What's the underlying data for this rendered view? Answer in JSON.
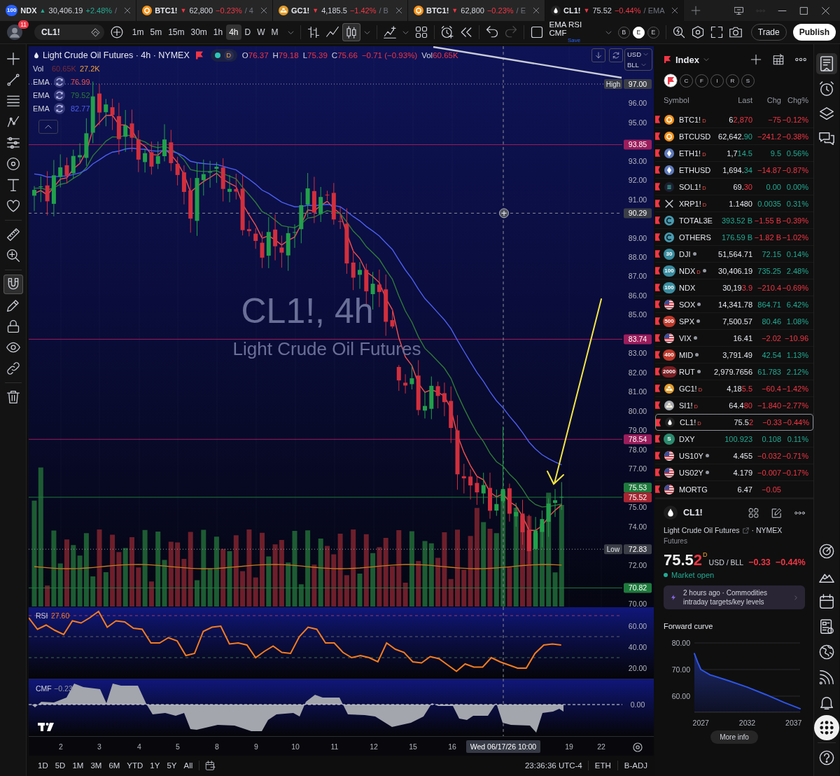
{
  "tabs": [
    {
      "symbol": "NDX",
      "arrow": "▲",
      "price": "30,406.19",
      "change": "+2.48%",
      "suffix": "/",
      "up": true,
      "selected": false,
      "logo": {
        "kind": "badge",
        "text": "100",
        "color": "#2962ff"
      }
    },
    {
      "symbol": "BTC1!",
      "arrow": "▼",
      "price": "62,800",
      "change": "−0.23%",
      "suffix": "/ 4",
      "up": false,
      "selected": false,
      "logo": {
        "kind": "coin",
        "color": "#f7931a"
      }
    },
    {
      "symbol": "GC1!",
      "arrow": "▼",
      "price": "4,185.5",
      "change": "−1.42%",
      "suffix": "/ B",
      "up": false,
      "selected": false,
      "logo": {
        "kind": "bars",
        "color": "#e39c2b"
      }
    },
    {
      "symbol": "BTC1!",
      "arrow": "▼",
      "price": "62,800",
      "change": "−0.23%",
      "suffix": "/ E",
      "up": false,
      "selected": false,
      "logo": {
        "kind": "coin",
        "color": "#f7931a"
      }
    },
    {
      "symbol": "CL1!",
      "arrow": "▼",
      "price": "75.52",
      "change": "−0.44%",
      "suffix": "/ EMA",
      "up": false,
      "selected": true,
      "logo": {
        "kind": "drop"
      }
    }
  ],
  "toolbar": {
    "notification_count": "11",
    "symbol": "CL1!",
    "intervals": [
      {
        "label": "1m",
        "selected": false
      },
      {
        "label": "5m",
        "selected": false
      },
      {
        "label": "15m",
        "selected": false
      },
      {
        "label": "30m",
        "selected": false
      },
      {
        "label": "1h",
        "selected": false
      },
      {
        "label": "4h",
        "selected": true
      },
      {
        "label": "D",
        "selected": false
      },
      {
        "label": "W",
        "selected": false
      },
      {
        "label": "M",
        "selected": false
      }
    ],
    "chart_styles": [
      {
        "selected": false
      },
      {
        "selected": false
      },
      {
        "selected": true
      }
    ],
    "history": [
      {
        "disabled": false
      },
      {
        "disabled": true
      }
    ],
    "layout": {
      "name": "EMA RSI CMF",
      "status": "Save"
    },
    "sessions": [
      {
        "label": "B",
        "selected": false
      },
      {
        "label": "E",
        "selected": true
      },
      {
        "label": "E",
        "selected": false
      }
    ],
    "trade": "Trade",
    "publish": "Publish"
  },
  "drawing_tools": [
    {
      "selected": false
    },
    {
      "selected": false
    },
    {
      "selected": false
    },
    {
      "selected": false
    },
    {
      "selected": false
    },
    {
      "selected": false
    },
    {
      "selected": false
    },
    {
      "selected": false
    },
    {
      "selected": false
    },
    {
      "selected": false
    },
    {
      "selected": true
    },
    {
      "selected": false
    },
    {
      "selected": false
    },
    {
      "selected": false
    },
    {
      "selected": false
    },
    {
      "selected": false
    }
  ],
  "chart": {
    "title": "Light Crude Oil Futures · 4h · NYMEX",
    "session_badge": "D",
    "ohlc": [
      {
        "label": "O",
        "value": "76.37"
      },
      {
        "label": "H",
        "value": "79.18"
      },
      {
        "label": "L",
        "value": "75.39"
      },
      {
        "label": "C",
        "value": "75.66"
      }
    ],
    "change": "−0.71 (−0.93%)",
    "up": false,
    "volume": {
      "label": "Vol",
      "value": "60.65K"
    },
    "volume_legend": {
      "label": "Vol",
      "values": [
        {
          "text": "60.65K",
          "color": "#7a2b33"
        },
        {
          "text": "27.2K",
          "color": "#f0a035"
        }
      ]
    },
    "emas": [
      {
        "label": "EMA",
        "value": "76.99",
        "color": "#f0504f"
      },
      {
        "label": "EMA",
        "value": "79.52",
        "color": "#2f7a39"
      },
      {
        "label": "EMA",
        "value": "82.77",
        "color": "#4c5ff0"
      }
    ],
    "currency": "USD",
    "unit": "BLL",
    "watermark": {
      "symbol": "CL1!, 4h",
      "name": "Light Crude Oil Futures"
    },
    "price_ticks": [
      "96.00",
      "95.00",
      "93.00",
      "92.00",
      "91.00",
      "89.00",
      "88.00",
      "87.00",
      "86.00",
      "85.00",
      "83.00",
      "82.00",
      "81.00",
      "80.00",
      "79.00",
      "78.00",
      "77.00",
      "75.00",
      "74.00",
      "72.00",
      "70.00"
    ],
    "price_labels": [
      {
        "text": "97.00",
        "tag": "High",
        "kind": "extreme",
        "color": "#3b3e46"
      },
      {
        "text": "93.85",
        "kind": "level",
        "color": "#9c1d5c"
      },
      {
        "text": "90.29",
        "kind": "crosshair",
        "color": "#3b3e46"
      },
      {
        "text": "83.74",
        "kind": "level",
        "color": "#9c1d5c"
      },
      {
        "text": "78.54",
        "kind": "level",
        "color": "#9c1d5c"
      },
      {
        "text": "75.53",
        "kind": "level",
        "color": "#1e7a3c"
      },
      {
        "text": "75.52",
        "kind": "last",
        "color": "#a82632"
      },
      {
        "text": "72.83",
        "tag": "Low",
        "kind": "extreme",
        "color": "#3b3e46"
      },
      {
        "text": "70.82",
        "kind": "level",
        "color": "#1e7a3c"
      }
    ],
    "time_axis": [
      {
        "text": "2",
        "kind": "date"
      },
      {
        "text": "3",
        "kind": "date"
      },
      {
        "text": "4",
        "kind": "date"
      },
      {
        "text": "5",
        "kind": "date"
      },
      {
        "text": "8",
        "kind": "date"
      },
      {
        "text": "9",
        "kind": "date"
      },
      {
        "text": "10",
        "kind": "date"
      },
      {
        "text": "11",
        "kind": "date"
      },
      {
        "text": "12",
        "kind": "date"
      },
      {
        "text": "15",
        "kind": "date"
      },
      {
        "text": "16",
        "kind": "date"
      },
      {
        "text": "Wed 06/17/26 10:00",
        "kind": "crosshair"
      },
      {
        "text": "19",
        "kind": "date"
      },
      {
        "text": "22",
        "kind": "date"
      }
    ]
  },
  "rsi": {
    "value": "27.60",
    "chart_data": {
      "type": "line",
      "ylim": [
        10,
        78
      ],
      "yticks": [
        {
          "value": 20,
          "label": "20.00"
        },
        {
          "value": 40,
          "label": "40.00"
        },
        {
          "value": 60,
          "label": "60.00"
        }
      ],
      "ref_lines": [
        {
          "axis": "y",
          "value": 70,
          "color": "#9c3a6a"
        },
        {
          "axis": "y",
          "value": 50,
          "color": "#5d6070"
        },
        {
          "axis": "y",
          "value": 30,
          "color": "#3f6b55"
        }
      ],
      "series": [
        {
          "name": "RSI",
          "color": "#f57c1f",
          "values": [
            68,
            57,
            61,
            56,
            52,
            65,
            63,
            68,
            74,
            59,
            65,
            64,
            58,
            57,
            44,
            44,
            49,
            46,
            32,
            34,
            55,
            59,
            60,
            43,
            44,
            42,
            30,
            36,
            41,
            35,
            34,
            50,
            59,
            57,
            44,
            44,
            35,
            30,
            32,
            30,
            26,
            44,
            38,
            35,
            26,
            25,
            31,
            29,
            23,
            17,
            24,
            21,
            21,
            30,
            26,
            23,
            20,
            20,
            34,
            42,
            43,
            42,
            null,
            null,
            null,
            null,
            null,
            null,
            null
          ]
        }
      ]
    }
  },
  "cmf": {
    "label": "CMF",
    "value": "−0.23",
    "zero_tick": "0.00"
  },
  "range_bar": {
    "ranges": [
      "1D",
      "5D",
      "1M",
      "3M",
      "6M",
      "YTD",
      "1Y",
      "5Y",
      "All"
    ],
    "clock": "23:36:36 UTC-4",
    "session": "ETH",
    "adjustment": "B-ADJ"
  },
  "watchlist": {
    "title": "Index",
    "filters": [
      {
        "kind": "flag",
        "selected": true
      },
      {
        "kind": "letter",
        "label": "C",
        "selected": false
      },
      {
        "kind": "letter",
        "label": "F",
        "selected": false
      },
      {
        "kind": "letter",
        "label": "I",
        "selected": false
      },
      {
        "kind": "letter",
        "label": "R",
        "selected": false
      },
      {
        "kind": "letter",
        "label": "S",
        "selected": false
      }
    ],
    "columns": [
      "Symbol",
      "Last",
      "Chg",
      "Chg%"
    ],
    "rows": [
      {
        "symbol": "BTC1!",
        "badge": "D",
        "market_closed": false,
        "logo": {
          "kind": "coin",
          "color": "#f7931a"
        },
        "last_head": "6",
        "last_tail": "2,870",
        "tail_up": false,
        "chg": "−75",
        "chg_pct": "−0.12%",
        "up": false,
        "selected": false
      },
      {
        "symbol": "BTCUSD",
        "market_closed": false,
        "logo": {
          "kind": "coin",
          "color": "#f7931a"
        },
        "last_head": "62,642.",
        "last_tail": "90",
        "tail_up": true,
        "chg": "−241.2",
        "chg_pct": "−0.38%",
        "up": false,
        "selected": false
      },
      {
        "symbol": "ETH1!",
        "badge": "D",
        "market_closed": false,
        "logo": {
          "kind": "token",
          "color": "#5f7bbd"
        },
        "last_head": "1,7",
        "last_tail": "14.5",
        "tail_up": true,
        "chg": "9.5",
        "chg_pct": "0.56%",
        "up": true,
        "selected": false
      },
      {
        "symbol": "ETHUSD",
        "market_closed": false,
        "logo": {
          "kind": "token",
          "color": "#5f7bbd"
        },
        "last_head": "1,694.",
        "last_tail": "34",
        "tail_up": true,
        "chg": "−14.87",
        "chg_pct": "−0.87%",
        "up": false,
        "selected": false
      },
      {
        "symbol": "SOL1!",
        "badge": "D",
        "market_closed": false,
        "logo": {
          "kind": "stripes",
          "color": "#1d2030"
        },
        "last_head": "69.",
        "last_tail": "30",
        "tail_up": false,
        "chg": "0.00",
        "chg_pct": "0.00%",
        "up": true,
        "selected": false
      },
      {
        "symbol": "XRP1!",
        "badge": "D",
        "market_closed": false,
        "logo": {
          "kind": "cross"
        },
        "last_head": "1.1480",
        "chg": "0.0035",
        "chg_pct": "0.31%",
        "up": true,
        "selected": false
      },
      {
        "symbol": "TOTAL3E",
        "market_closed": false,
        "logo": {
          "kind": "ring",
          "color": "#4a9bb0"
        },
        "last_tail": "393.52 B",
        "tail_up": true,
        "chg": "−1.55 B",
        "chg_pct": "−0.39%",
        "up": false,
        "selected": false
      },
      {
        "symbol": "OTHERS",
        "market_closed": false,
        "logo": {
          "kind": "ring",
          "color": "#4a9bb0"
        },
        "last_tail": "176.59 B",
        "tail_up": true,
        "chg": "−1.82 B",
        "chg_pct": "−1.02%",
        "up": false,
        "selected": false
      },
      {
        "symbol": "DJI",
        "market_closed": true,
        "logo": {
          "kind": "badge",
          "text": "30",
          "color": "#3a8da0"
        },
        "last_head": "51,564.71",
        "chg": "72.15",
        "chg_pct": "0.14%",
        "up": true,
        "selected": false
      },
      {
        "symbol": "NDX",
        "badge": "D",
        "market_closed": true,
        "logo": {
          "kind": "badge",
          "text": "100",
          "color": "#3a8da0"
        },
        "last_head": "30,406.19",
        "chg": "735.25",
        "chg_pct": "2.48%",
        "up": true,
        "selected": false
      },
      {
        "symbol": "NDX",
        "market_closed": false,
        "logo": {
          "kind": "badge",
          "text": "100",
          "color": "#3a8da0"
        },
        "last_head": "30,19",
        "last_tail": "3.9",
        "tail_up": false,
        "chg": "−210.4",
        "chg_pct": "−0.69%",
        "up": false,
        "selected": false
      },
      {
        "symbol": "SOX",
        "market_closed": true,
        "logo": {
          "kind": "flag"
        },
        "last_head": "14,341.78",
        "chg": "864.71",
        "chg_pct": "6.42%",
        "up": true,
        "selected": false
      },
      {
        "symbol": "SPX",
        "market_closed": true,
        "logo": {
          "kind": "badge",
          "text": "500",
          "color": "#c0392b"
        },
        "last_head": "7,500.57",
        "chg": "80.46",
        "chg_pct": "1.08%",
        "up": true,
        "selected": false
      },
      {
        "symbol": "VIX",
        "market_closed": true,
        "logo": {
          "kind": "flag"
        },
        "last_head": "16.41",
        "chg": "−2.02",
        "chg_pct": "−10.96",
        "up": false,
        "selected": false
      },
      {
        "symbol": "MID",
        "market_closed": true,
        "logo": {
          "kind": "badge",
          "text": "400",
          "color": "#c0392b"
        },
        "last_head": "3,791.49",
        "chg": "42.54",
        "chg_pct": "1.13%",
        "up": true,
        "selected": false
      },
      {
        "symbol": "RUT",
        "market_closed": true,
        "logo": {
          "kind": "badge",
          "text": "2000",
          "color": "#7b1f24"
        },
        "last_head": "2,979.7656",
        "chg": "61.783",
        "chg_pct": "2.12%",
        "up": true,
        "selected": false
      },
      {
        "symbol": "GC1!",
        "badge": "D",
        "market_closed": false,
        "logo": {
          "kind": "bars",
          "color": "#e39c2b"
        },
        "last_head": "4,18",
        "last_tail": "5.5",
        "tail_up": false,
        "chg": "−60.4",
        "chg_pct": "−1.42%",
        "up": false,
        "selected": false
      },
      {
        "symbol": "SI1!",
        "badge": "D",
        "market_closed": false,
        "logo": {
          "kind": "bars",
          "color": "#a9acb3"
        },
        "last_head": "64.4",
        "last_tail": "80",
        "tail_up": false,
        "chg": "−1.840",
        "chg_pct": "−2.77%",
        "up": false,
        "selected": false
      },
      {
        "symbol": "CL1!",
        "badge": "D",
        "market_closed": false,
        "logo": {
          "kind": "drop"
        },
        "last_head": "75.5",
        "last_tail": "2",
        "tail_up": false,
        "chg": "−0.33",
        "chg_pct": "−0.44%",
        "up": false,
        "selected": true
      },
      {
        "symbol": "DXY",
        "market_closed": false,
        "logo": {
          "kind": "badge",
          "text": "S",
          "color": "#2b8a6e"
        },
        "last_tail": "100.923",
        "tail_up": true,
        "chg": "0.108",
        "chg_pct": "0.11%",
        "up": true,
        "selected": false
      },
      {
        "symbol": "US10Y",
        "market_closed": true,
        "logo": {
          "kind": "flag"
        },
        "last_head": "4.455",
        "chg": "−0.032",
        "chg_pct": "−0.71%",
        "up": false,
        "selected": false
      },
      {
        "symbol": "US02Y",
        "market_closed": true,
        "logo": {
          "kind": "flag"
        },
        "last_head": "4.179",
        "chg": "−0.007",
        "chg_pct": "−0.17%",
        "up": false,
        "selected": false
      },
      {
        "symbol": "MORTG",
        "market_closed": false,
        "logo": {
          "kind": "flag"
        },
        "last_head": "6.47",
        "chg": "−0.05",
        "up": false,
        "selected": false
      }
    ]
  },
  "details": {
    "symbol": "CL1!",
    "name": "Light Crude Oil Futures",
    "exchange": "· NYMEX",
    "type": "Futures",
    "price_head": "75.5",
    "price_tail": "2",
    "tail_up": false,
    "price_badge": "D",
    "unit": "USD / BLL",
    "change": "−0.33",
    "change_pct": "−0.44%",
    "up": false,
    "status": "Market open",
    "news": {
      "meta": "2 hours ago · Commodities",
      "headline": "intraday targets/key levels"
    },
    "chart_data": {
      "type": "area",
      "title": "Forward curve",
      "grid": true,
      "x": [
        2026.3,
        2026.65,
        2027,
        2028,
        2030,
        2032,
        2034,
        2036,
        2037.7
      ],
      "xlim": [
        2026.3,
        2037.7
      ],
      "ylim": [
        54,
        80
      ],
      "xticks": [
        2027,
        2032,
        2037
      ],
      "yticks": [
        {
          "value": 60,
          "label": "60.00"
        },
        {
          "value": 70,
          "label": "70.00"
        },
        {
          "value": 80,
          "label": "80.00"
        }
      ],
      "series": [
        {
          "color": "#2f55e6",
          "values": [
            76,
            72.8,
            70,
            68,
            65.8,
            63.4,
            60.6,
            57.6,
            55.3
          ]
        }
      ]
    },
    "more": "More info"
  },
  "side_bar": {
    "top": [
      {
        "selected": true
      },
      {
        "selected": false
      },
      {
        "selected": false
      },
      {
        "selected": false
      }
    ],
    "bottom": [
      {
        "selected": false
      },
      {
        "selected": false
      },
      {
        "selected": false
      },
      {
        "selected": false
      },
      {
        "selected": false
      },
      {
        "selected": false
      },
      {
        "selected": false
      },
      {
        "selected": true
      },
      {
        "selected": false
      }
    ]
  }
}
